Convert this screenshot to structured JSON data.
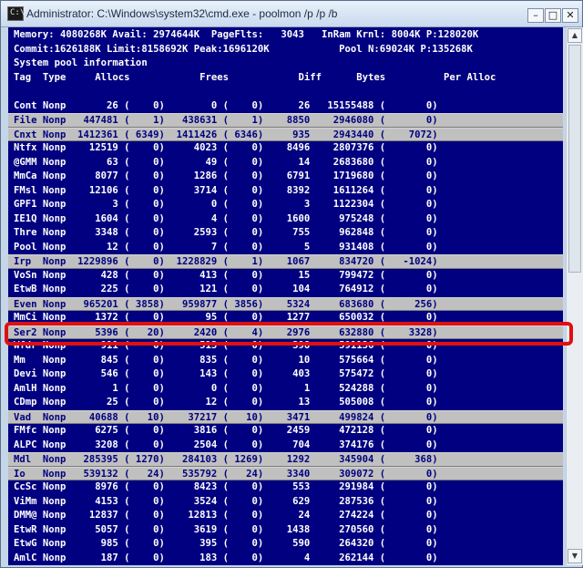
{
  "window": {
    "title": "Administrator: C:\\Windows\\system32\\cmd.exe - poolmon  /p /p /b",
    "icon_text": "C:\\",
    "buttons": {
      "minimize": "–",
      "maximize": "□",
      "close": "✕"
    }
  },
  "console": {
    "header_lines": [
      "Memory: 4080268K Avail: 2974644K  PageFlts:   3043   InRam Krnl: 8004K P:128020K",
      "Commit:1626188K Limit:8158692K Peak:1696120K            Pool N:69024K P:135268K",
      "System pool information",
      "Tag  Type     Allocs            Frees            Diff      Bytes          Per Alloc"
    ],
    "rows": [
      {
        "text": "",
        "inverted": false
      },
      {
        "text": "Cont Nonp       26 (    0)        0 (    0)      26   15155488 (       0)",
        "inverted": false
      },
      {
        "text": "File Nonp   447481 (    1)   438631 (    1)    8850    2946080 (       0)",
        "inverted": true
      },
      {
        "text": "Cnxt Nonp  1412361 ( 6349)  1411426 ( 6346)     935    2943440 (    7072)",
        "inverted": true
      },
      {
        "text": "Ntfx Nonp    12519 (    0)     4023 (    0)    8496    2807376 (       0)",
        "inverted": false
      },
      {
        "text": "@GMM Nonp       63 (    0)       49 (    0)      14    2683680 (       0)",
        "inverted": false
      },
      {
        "text": "MmCa Nonp     8077 (    0)     1286 (    0)    6791    1719680 (       0)",
        "inverted": false
      },
      {
        "text": "FMsl Nonp    12106 (    0)     3714 (    0)    8392    1611264 (       0)",
        "inverted": false
      },
      {
        "text": "GPF1 Nonp        3 (    0)        0 (    0)       3    1122304 (       0)",
        "inverted": false
      },
      {
        "text": "IE1Q Nonp     1604 (    0)        4 (    0)    1600     975248 (       0)",
        "inverted": false
      },
      {
        "text": "Thre Nonp     3348 (    0)     2593 (    0)     755     962848 (       0)",
        "inverted": false
      },
      {
        "text": "Pool Nonp       12 (    0)        7 (    0)       5     931408 (       0)",
        "inverted": false
      },
      {
        "text": "Irp  Nonp  1229896 (    0)  1228829 (    1)    1067     834720 (   -1024)",
        "inverted": true
      },
      {
        "text": "VoSn Nonp      428 (    0)      413 (    0)      15     799472 (       0)",
        "inverted": false
      },
      {
        "text": "EtwB Nonp      225 (    0)      121 (    0)     104     764912 (       0)",
        "inverted": false
      },
      {
        "text": "Even Nonp   965201 ( 3858)   959877 ( 3856)    5324     683680 (     256)",
        "inverted": true
      },
      {
        "text": "MmCi Nonp     1372 (    0)       95 (    0)    1277     650032 (       0)",
        "inverted": false
      },
      {
        "text": "Ser2 Nonp     5396 (   20)     2420 (    4)    2976     632880 (    3328)",
        "inverted": true
      },
      {
        "text": "Wfdr Nonp      911 (    0)      513 (    0)     398     591136 (       0)",
        "inverted": false
      },
      {
        "text": "Mm   Nonp      845 (    0)      835 (    0)      10     575664 (       0)",
        "inverted": false
      },
      {
        "text": "Devi Nonp      546 (    0)      143 (    0)     403     575472 (       0)",
        "inverted": false
      },
      {
        "text": "AmlH Nonp        1 (    0)        0 (    0)       1     524288 (       0)",
        "inverted": false
      },
      {
        "text": "CDmp Nonp       25 (    0)       12 (    0)      13     505008 (       0)",
        "inverted": false
      },
      {
        "text": "Vad  Nonp    40688 (   10)    37217 (   10)    3471     499824 (       0)",
        "inverted": true
      },
      {
        "text": "FMfc Nonp     6275 (    0)     3816 (    0)    2459     472128 (       0)",
        "inverted": false
      },
      {
        "text": "ALPC Nonp     3208 (    0)     2504 (    0)     704     374176 (       0)",
        "inverted": false
      },
      {
        "text": "Mdl  Nonp   285395 ( 1270)   284103 ( 1269)    1292     345904 (     368)",
        "inverted": true
      },
      {
        "text": "Io   Nonp   539132 (   24)   535792 (   24)    3340     309072 (       0)",
        "inverted": true
      },
      {
        "text": "CcSc Nonp     8976 (    0)     8423 (    0)     553     291984 (       0)",
        "inverted": false
      },
      {
        "text": "ViMm Nonp     4153 (    0)     3524 (    0)     629     287536 (       0)",
        "inverted": false
      },
      {
        "text": "DMM@ Nonp    12837 (    0)    12813 (    0)      24     274224 (       0)",
        "inverted": false
      },
      {
        "text": "EtwR Nonp     5057 (    0)     3619 (    0)    1438     270560 (       0)",
        "inverted": false
      },
      {
        "text": "EtwG Nonp      985 (    0)      395 (    0)     590     264320 (       0)",
        "inverted": false
      },
      {
        "text": "AmlC Nonp      187 (    0)      183 (    0)       4     262144 (       0)",
        "inverted": false
      }
    ]
  },
  "scrollbar": {
    "up_arrow": "▲",
    "down_arrow": "▼"
  },
  "highlight": {
    "color": "#e01010",
    "target_tag": "Ser2"
  },
  "colors": {
    "console_bg": "#000080",
    "console_fg": "#ffffff",
    "inverted_bg": "#c0c0c0",
    "inverted_fg": "#000080"
  }
}
